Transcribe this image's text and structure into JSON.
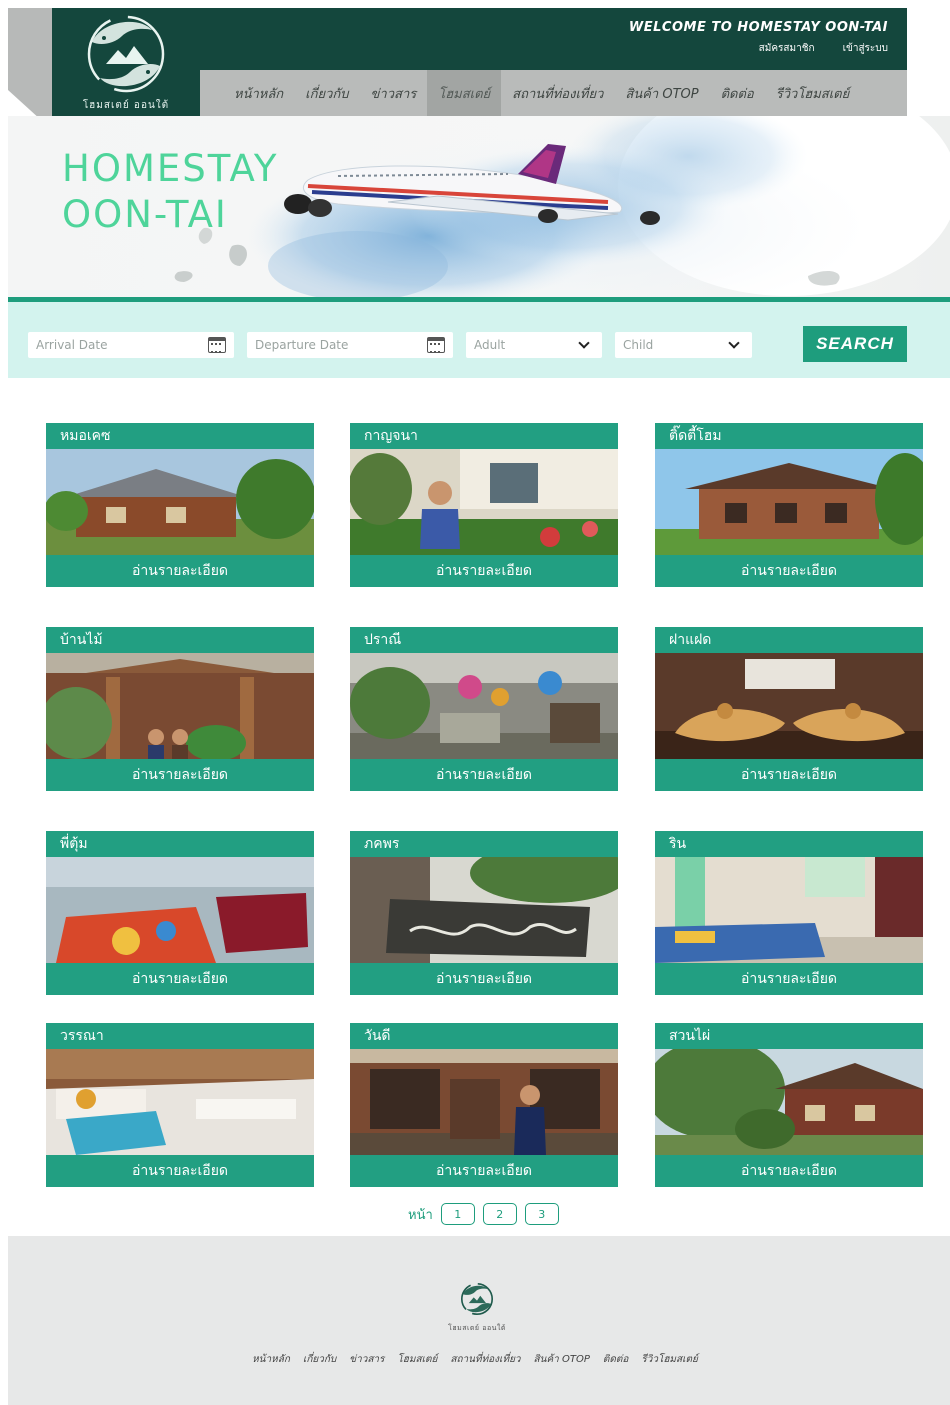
{
  "header": {
    "logo_text": "โฮมสเตย์ ออนใต้",
    "welcome": "WELCOME TO HOMESTAY OON-TAI",
    "register": "สมัครสมาชิก",
    "login": "เข้าสู่ระบบ",
    "nav": [
      "หน้าหลัก",
      "เกี่ยวกับ",
      "ข่าวสาร",
      "โฮมสเตย์",
      "สถานที่ท่องเที่ยว",
      "สินค้า OTOP",
      "ติดต่อ",
      "รีวิวโฮมสเตย์"
    ],
    "active_nav": "โฮมสเตย์"
  },
  "hero": {
    "title_line1": "HOMESTAY",
    "title_line2": "OON-TAI"
  },
  "search": {
    "arrival_placeholder": "Arrival Date",
    "departure_placeholder": "Departure Date",
    "adult_placeholder": "Adult",
    "child_placeholder": "Child",
    "button": "SEARCH"
  },
  "cards": [
    {
      "name": "หมอเคซ",
      "more": "อ่านรายละเอียด",
      "scene": "house"
    },
    {
      "name": "กาญจนา",
      "more": "อ่านรายละเอียด",
      "scene": "person-garden"
    },
    {
      "name": "ติ๊ดตี้โฮม",
      "more": "อ่านรายละเอียด",
      "scene": "wooden-house"
    },
    {
      "name": "บ้านไม้",
      "more": "อ่านรายละเอียด",
      "scene": "porch"
    },
    {
      "name": "ปราณี",
      "more": "อ่านรายละเอียด",
      "scene": "yard"
    },
    {
      "name": "ฝาแฝด",
      "more": "อ่านรายละเอียด",
      "scene": "carving"
    },
    {
      "name": "พี่ตุ้ม",
      "more": "อ่านรายละเอียด",
      "scene": "bed"
    },
    {
      "name": "ภคพร",
      "more": "อ่านรายละเอียด",
      "scene": "sign"
    },
    {
      "name": "ริน",
      "more": "อ่านรายละเอียด",
      "scene": "room"
    },
    {
      "name": "วรรณา",
      "more": "อ่านรายละเอียด",
      "scene": "mattress"
    },
    {
      "name": "วันดี",
      "more": "อ่านรายละเอียด",
      "scene": "person-house"
    },
    {
      "name": "สวนไผ่",
      "more": "อ่านรายละเอียด",
      "scene": "garden-house"
    }
  ],
  "pagination": {
    "label": "หน้า",
    "pages": [
      "1",
      "2",
      "3"
    ]
  },
  "footer": {
    "logo_text": "โฮมสเตย์ ออนใต้",
    "nav": [
      "หน้าหลัก",
      "เกี่ยวกับ",
      "ข่าวสาร",
      "โฮมสเตย์",
      "สถานที่ท่องเที่ยว",
      "สินค้า OTOP",
      "ติดต่อ",
      "รีวิวโฮมสเตย์"
    ]
  },
  "colors": {
    "header_dark": "#14473d",
    "accent_green": "#229f82",
    "hero_title": "#4ed49a",
    "search_band": "#d3f3ee"
  }
}
